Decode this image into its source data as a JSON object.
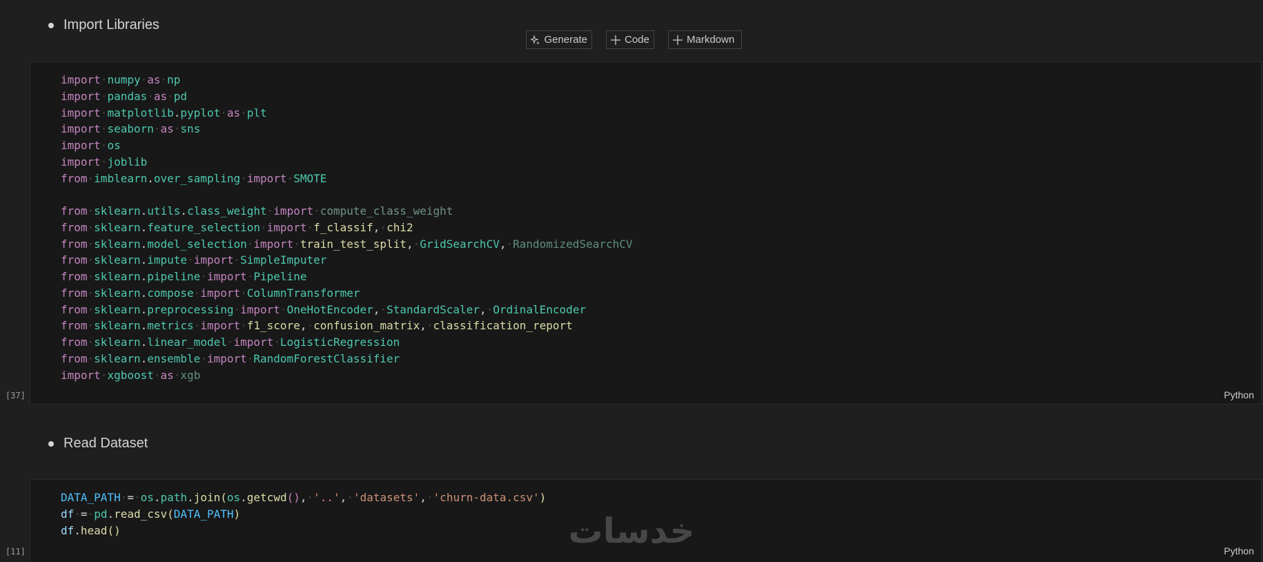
{
  "headings": {
    "import_libraries": "Import Libraries",
    "read_dataset": "Read Dataset"
  },
  "toolbar": {
    "generate_label": "Generate",
    "code_label": "Code",
    "markdown_label": "Markdown"
  },
  "cells": [
    {
      "execution_count": "[37]",
      "language": "Python",
      "lines": [
        [
          [
            "import",
            "kw"
          ],
          [
            "·",
            "ws"
          ],
          [
            "numpy",
            "mod"
          ],
          [
            "·",
            "ws"
          ],
          [
            "as",
            "kw"
          ],
          [
            "·",
            "ws"
          ],
          [
            "np",
            "mod"
          ]
        ],
        [
          [
            "import",
            "kw"
          ],
          [
            "·",
            "ws"
          ],
          [
            "pandas",
            "mod"
          ],
          [
            "·",
            "ws"
          ],
          [
            "as",
            "kw"
          ],
          [
            "·",
            "ws"
          ],
          [
            "pd",
            "mod"
          ]
        ],
        [
          [
            "import",
            "kw"
          ],
          [
            "·",
            "ws"
          ],
          [
            "matplotlib",
            "mod"
          ],
          [
            ".",
            "op"
          ],
          [
            "pyplot",
            "mod"
          ],
          [
            "·",
            "ws"
          ],
          [
            "as",
            "kw"
          ],
          [
            "·",
            "ws"
          ],
          [
            "plt",
            "mod"
          ]
        ],
        [
          [
            "import",
            "kw"
          ],
          [
            "·",
            "ws"
          ],
          [
            "seaborn",
            "mod"
          ],
          [
            "·",
            "ws"
          ],
          [
            "as",
            "kw"
          ],
          [
            "·",
            "ws"
          ],
          [
            "sns",
            "mod"
          ]
        ],
        [
          [
            "import",
            "kw"
          ],
          [
            "·",
            "ws"
          ],
          [
            "os",
            "mod"
          ]
        ],
        [
          [
            "import",
            "kw"
          ],
          [
            "·",
            "ws"
          ],
          [
            "joblib",
            "mod"
          ]
        ],
        [
          [
            "from",
            "kw"
          ],
          [
            "·",
            "ws"
          ],
          [
            "imblearn",
            "mod"
          ],
          [
            ".",
            "op"
          ],
          [
            "over_sampling",
            "mod"
          ],
          [
            "·",
            "ws"
          ],
          [
            "import",
            "kw"
          ],
          [
            "·",
            "ws"
          ],
          [
            "SMOTE",
            "mod"
          ]
        ],
        [],
        [
          [
            "from",
            "kw"
          ],
          [
            "·",
            "ws"
          ],
          [
            "sklearn",
            "mod"
          ],
          [
            ".",
            "op"
          ],
          [
            "utils",
            "mod"
          ],
          [
            ".",
            "op"
          ],
          [
            "class_weight",
            "mod"
          ],
          [
            "·",
            "ws"
          ],
          [
            "import",
            "kw"
          ],
          [
            "·",
            "ws"
          ],
          [
            "compute_class_weight",
            "un"
          ]
        ],
        [
          [
            "from",
            "kw"
          ],
          [
            "·",
            "ws"
          ],
          [
            "sklearn",
            "mod"
          ],
          [
            ".",
            "op"
          ],
          [
            "feature_selection",
            "mod"
          ],
          [
            "·",
            "ws"
          ],
          [
            "import",
            "kw"
          ],
          [
            "·",
            "ws"
          ],
          [
            "f_classif",
            "fn"
          ],
          [
            ",",
            "op"
          ],
          [
            "·",
            "ws"
          ],
          [
            "chi2",
            "fn"
          ]
        ],
        [
          [
            "from",
            "kw"
          ],
          [
            "·",
            "ws"
          ],
          [
            "sklearn",
            "mod"
          ],
          [
            ".",
            "op"
          ],
          [
            "model_selection",
            "mod"
          ],
          [
            "·",
            "ws"
          ],
          [
            "import",
            "kw"
          ],
          [
            "·",
            "ws"
          ],
          [
            "train_test_split",
            "fn"
          ],
          [
            ",",
            "op"
          ],
          [
            "·",
            "ws"
          ],
          [
            "GridSearchCV",
            "mod"
          ],
          [
            ",",
            "op"
          ],
          [
            "·",
            "ws"
          ],
          [
            "RandomizedSearchCV",
            "dim"
          ]
        ],
        [
          [
            "from",
            "kw"
          ],
          [
            "·",
            "ws"
          ],
          [
            "sklearn",
            "mod"
          ],
          [
            ".",
            "op"
          ],
          [
            "impute",
            "mod"
          ],
          [
            "·",
            "ws"
          ],
          [
            "import",
            "kw"
          ],
          [
            "·",
            "ws"
          ],
          [
            "SimpleImputer",
            "mod"
          ]
        ],
        [
          [
            "from",
            "kw"
          ],
          [
            "·",
            "ws"
          ],
          [
            "sklearn",
            "mod"
          ],
          [
            ".",
            "op"
          ],
          [
            "pipeline",
            "mod"
          ],
          [
            "·",
            "ws"
          ],
          [
            "import",
            "kw"
          ],
          [
            "·",
            "ws"
          ],
          [
            "Pipeline",
            "mod"
          ]
        ],
        [
          [
            "from",
            "kw"
          ],
          [
            "·",
            "ws"
          ],
          [
            "sklearn",
            "mod"
          ],
          [
            ".",
            "op"
          ],
          [
            "compose",
            "mod"
          ],
          [
            "·",
            "ws"
          ],
          [
            "import",
            "kw"
          ],
          [
            "·",
            "ws"
          ],
          [
            "ColumnTransformer",
            "mod"
          ]
        ],
        [
          [
            "from",
            "kw"
          ],
          [
            "·",
            "ws"
          ],
          [
            "sklearn",
            "mod"
          ],
          [
            ".",
            "op"
          ],
          [
            "preprocessing",
            "mod"
          ],
          [
            "·",
            "ws"
          ],
          [
            "import",
            "kw"
          ],
          [
            "·",
            "ws"
          ],
          [
            "OneHotEncoder",
            "mod"
          ],
          [
            ",",
            "op"
          ],
          [
            "·",
            "ws"
          ],
          [
            "StandardScaler",
            "mod"
          ],
          [
            ",",
            "op"
          ],
          [
            "·",
            "ws"
          ],
          [
            "OrdinalEncoder",
            "mod"
          ]
        ],
        [
          [
            "from",
            "kw"
          ],
          [
            "·",
            "ws"
          ],
          [
            "sklearn",
            "mod"
          ],
          [
            ".",
            "op"
          ],
          [
            "metrics",
            "mod"
          ],
          [
            "·",
            "ws"
          ],
          [
            "import",
            "kw"
          ],
          [
            "·",
            "ws"
          ],
          [
            "f1_score",
            "fn"
          ],
          [
            ",",
            "op"
          ],
          [
            "·",
            "ws"
          ],
          [
            "confusion_matrix",
            "fn"
          ],
          [
            ",",
            "op"
          ],
          [
            "·",
            "ws"
          ],
          [
            "classification_report",
            "fn"
          ]
        ],
        [
          [
            "from",
            "kw"
          ],
          [
            "·",
            "ws"
          ],
          [
            "sklearn",
            "mod"
          ],
          [
            ".",
            "op"
          ],
          [
            "linear_model",
            "mod"
          ],
          [
            "·",
            "ws"
          ],
          [
            "import",
            "kw"
          ],
          [
            "·",
            "ws"
          ],
          [
            "LogisticRegression",
            "mod"
          ]
        ],
        [
          [
            "from",
            "kw"
          ],
          [
            "·",
            "ws"
          ],
          [
            "sklearn",
            "mod"
          ],
          [
            ".",
            "op"
          ],
          [
            "ensemble",
            "mod"
          ],
          [
            "·",
            "ws"
          ],
          [
            "import",
            "kw"
          ],
          [
            "·",
            "ws"
          ],
          [
            "RandomForestClassifier",
            "mod"
          ]
        ],
        [
          [
            "import",
            "kw"
          ],
          [
            "·",
            "ws"
          ],
          [
            "xgboost",
            "mod"
          ],
          [
            "·",
            "ws"
          ],
          [
            "as",
            "kw"
          ],
          [
            "·",
            "ws"
          ],
          [
            "xgb",
            "dim"
          ]
        ]
      ]
    },
    {
      "execution_count": "[11]",
      "language": "Python",
      "lines": [
        [
          [
            "DATA_PATH",
            "cst"
          ],
          [
            "·",
            "ws"
          ],
          [
            "=",
            "op"
          ],
          [
            "·",
            "ws"
          ],
          [
            "os",
            "mod"
          ],
          [
            ".",
            "op"
          ],
          [
            "path",
            "mod"
          ],
          [
            ".",
            "op"
          ],
          [
            "join",
            "fn"
          ],
          [
            "(",
            "fn"
          ],
          [
            "os",
            "mod"
          ],
          [
            ".",
            "op"
          ],
          [
            "getcwd",
            "fn"
          ],
          [
            "()",
            "kw"
          ],
          [
            ",",
            "op"
          ],
          [
            "·",
            "ws"
          ],
          [
            "'..'",
            "str"
          ],
          [
            ",",
            "op"
          ],
          [
            "·",
            "ws"
          ],
          [
            "'datasets'",
            "str"
          ],
          [
            ",",
            "op"
          ],
          [
            "·",
            "ws"
          ],
          [
            "'churn-data.csv'",
            "str"
          ],
          [
            ")",
            "fn"
          ]
        ],
        [
          [
            "df",
            "var"
          ],
          [
            "·",
            "ws"
          ],
          [
            "=",
            "op"
          ],
          [
            "·",
            "ws"
          ],
          [
            "pd",
            "mod"
          ],
          [
            ".",
            "op"
          ],
          [
            "read_csv",
            "fn"
          ],
          [
            "(",
            "fn"
          ],
          [
            "DATA_PATH",
            "cst"
          ],
          [
            ")",
            "fn"
          ]
        ],
        [
          [
            "df",
            "var"
          ],
          [
            ".",
            "op"
          ],
          [
            "head",
            "fn"
          ],
          [
            "()",
            "fn"
          ]
        ]
      ]
    }
  ],
  "watermark": "خدسات"
}
